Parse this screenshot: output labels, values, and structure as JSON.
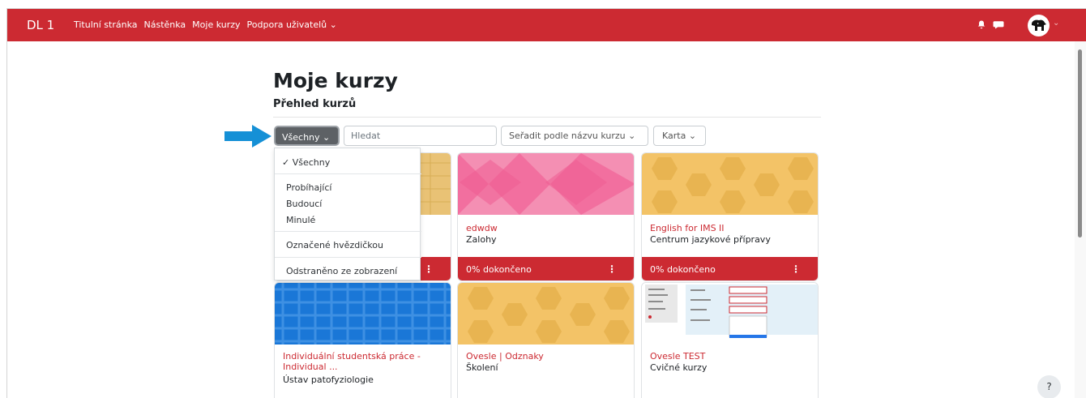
{
  "navbar": {
    "brand": "DL 1",
    "links": [
      "Titulní stránka",
      "Nástěnka",
      "Moje kurzy",
      "Podpora uživatelů"
    ]
  },
  "page": {
    "title": "Moje kurzy",
    "subtitle": "Přehled kurzů"
  },
  "toolbar": {
    "filter_label": "Všechny",
    "search_placeholder": "Hledat",
    "sort_label": "Seřadit podle názvu kurzu",
    "view_label": "Karta"
  },
  "dropdown": {
    "items": [
      "Všechny",
      "Probíhající",
      "Budoucí",
      "Minulé",
      "Označené hvězdičkou",
      "Odstraněno ze zobrazení"
    ]
  },
  "courses": [
    {
      "code": "",
      "category": "",
      "progress": ""
    },
    {
      "code": "edwdw",
      "category": "Zalohy",
      "progress": "0% dokončeno"
    },
    {
      "code": "English for IMS II",
      "category": "Centrum jazykové přípravy",
      "progress": "0% dokončeno"
    },
    {
      "code": "Individuální studentská práce - Individual ...",
      "category": "Ústav patofyziologie",
      "progress": ""
    },
    {
      "code": "Ovesle | Odznaky",
      "category": "Školení",
      "progress": ""
    },
    {
      "code": "Ovesle TEST",
      "category": "Cvičné kurzy",
      "progress": ""
    }
  ],
  "help": "?",
  "colors": {
    "brand_red": "#cc2a32",
    "dark_button": "#5d6165",
    "pink_pattern": "#f17aa5",
    "yellow_pattern": "#f3c367",
    "blue_pattern": "#1e78d8"
  },
  "icons": {
    "nav_caret": "chevron-down-icon",
    "notifications": "bell-icon",
    "messages": "chat-icon",
    "user": "avatar-icon",
    "course_menu": "dots-vertical-icon",
    "callout": "arrow-right-icon"
  }
}
